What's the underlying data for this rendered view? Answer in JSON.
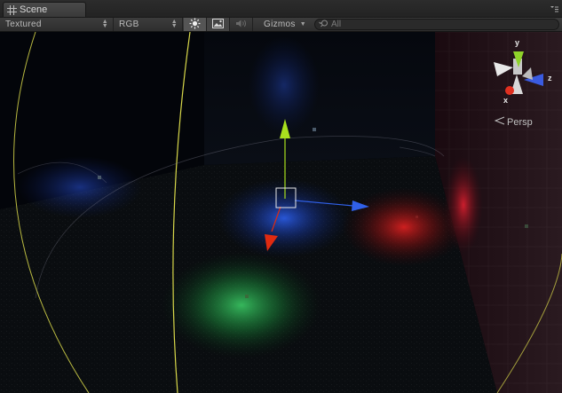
{
  "tab": {
    "title": "Scene",
    "icon": "grid-icon"
  },
  "toolbar": {
    "render_mode": "Textured",
    "channel_mode": "RGB",
    "lighting_toggle_icon": "sun-icon",
    "image_toggle_icon": "image-icon",
    "audio_toggle_icon": "speaker-icon",
    "gizmos_label": "Gizmos",
    "search_placeholder": "All"
  },
  "orientation_gizmo": {
    "axes": {
      "y": "y",
      "z": "z",
      "x": "x"
    },
    "projection_label": "Persp",
    "colors": {
      "y": "#8fd32a",
      "z": "#3a5be0",
      "x": "#e03020"
    }
  },
  "scene": {
    "lights": [
      {
        "name": "blue-light",
        "color": "#1f4cc8"
      },
      {
        "name": "red-light",
        "color": "#c81a1a"
      },
      {
        "name": "green-light",
        "color": "#1fa646"
      }
    ],
    "transform_handle_colors": {
      "y": "#a8e01e",
      "x": "#3060e8",
      "z": "#e02a10"
    },
    "light_range_color": "#d8d84a"
  }
}
